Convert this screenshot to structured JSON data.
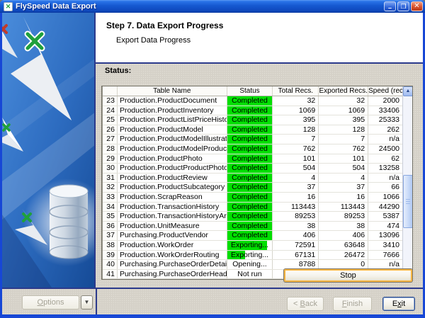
{
  "window": {
    "title": "FlySpeed Data Export"
  },
  "titlebar": {
    "minimize": "–",
    "maximize": "❐",
    "close": "✕"
  },
  "header": {
    "title": "Step 7. Data Export Progress",
    "subtitle": "Export Data Progress"
  },
  "status_label": "Status:",
  "table": {
    "columns": [
      "",
      "Table Name",
      "Status",
      "Total Recs.",
      "Exported Recs.",
      "Speed (rec/s)"
    ],
    "rows": [
      {
        "num": 23,
        "name": "Production.ProductDocument",
        "status": "Completed",
        "total": "32",
        "exported": "32",
        "speed": "2000",
        "fill": 100
      },
      {
        "num": 24,
        "name": "Production.ProductInventory",
        "status": "Completed",
        "total": "1069",
        "exported": "1069",
        "speed": "33406",
        "fill": 100
      },
      {
        "num": 25,
        "name": "Production.ProductListPriceHistory",
        "status": "Completed",
        "total": "395",
        "exported": "395",
        "speed": "25333",
        "fill": 100
      },
      {
        "num": 26,
        "name": "Production.ProductModel",
        "status": "Completed",
        "total": "128",
        "exported": "128",
        "speed": "262",
        "fill": 100
      },
      {
        "num": 27,
        "name": "Production.ProductModelIllustration",
        "status": "Completed",
        "total": "7",
        "exported": "7",
        "speed": "n/a",
        "fill": 100
      },
      {
        "num": 28,
        "name": "Production.ProductModelProductDescriptio",
        "status": "Completed",
        "total": "762",
        "exported": "762",
        "speed": "24500",
        "fill": 100
      },
      {
        "num": 29,
        "name": "Production.ProductPhoto",
        "status": "Completed",
        "total": "101",
        "exported": "101",
        "speed": "62",
        "fill": 100
      },
      {
        "num": 30,
        "name": "Production.ProductProductPhoto",
        "status": "Completed",
        "total": "504",
        "exported": "504",
        "speed": "13258",
        "fill": 100
      },
      {
        "num": 31,
        "name": "Production.ProductReview",
        "status": "Completed",
        "total": "4",
        "exported": "4",
        "speed": "n/a",
        "fill": 100
      },
      {
        "num": 32,
        "name": "Production.ProductSubcategory",
        "status": "Completed",
        "total": "37",
        "exported": "37",
        "speed": "66",
        "fill": 100
      },
      {
        "num": 33,
        "name": "Production.ScrapReason",
        "status": "Completed",
        "total": "16",
        "exported": "16",
        "speed": "1066",
        "fill": 100
      },
      {
        "num": 34,
        "name": "Production.TransactionHistory",
        "status": "Completed",
        "total": "113443",
        "exported": "113443",
        "speed": "44290",
        "fill": 100
      },
      {
        "num": 35,
        "name": "Production.TransactionHistoryArchive",
        "status": "Completed",
        "total": "89253",
        "exported": "89253",
        "speed": "5387",
        "fill": 100
      },
      {
        "num": 36,
        "name": "Production.UnitMeasure",
        "status": "Completed",
        "total": "38",
        "exported": "38",
        "speed": "474",
        "fill": 100
      },
      {
        "num": 37,
        "name": "Purchasing.ProductVendor",
        "status": "Completed",
        "total": "406",
        "exported": "406",
        "speed": "13096",
        "fill": 100
      },
      {
        "num": 38,
        "name": "Production.WorkOrder",
        "status": "Exporting...",
        "total": "72591",
        "exported": "63648",
        "speed": "3410",
        "fill": 88
      },
      {
        "num": 39,
        "name": "Production.WorkOrderRouting",
        "status": "Exporting...",
        "total": "67131",
        "exported": "26472",
        "speed": "7666",
        "fill": 40
      },
      {
        "num": 40,
        "name": "Purchasing.PurchaseOrderDetail",
        "status": "Opening...",
        "total": "8788",
        "exported": "0",
        "speed": "n/a",
        "fill": 0
      },
      {
        "num": 41,
        "name": "Purchasing.PurchaseOrderHeader",
        "status": "Not run",
        "total": "",
        "exported": "",
        "speed": "",
        "fill": 0
      }
    ]
  },
  "buttons": {
    "stop": "Stop",
    "options": {
      "pre": "",
      "key": "O",
      "post": "ptions"
    },
    "options_drop": "▼",
    "back": {
      "pre": "< ",
      "key": "B",
      "post": "ack"
    },
    "finish": {
      "pre": "",
      "key": "F",
      "post": "inish"
    },
    "exit": {
      "pre": "E",
      "key": "x",
      "post": "it"
    }
  },
  "scrollbar": {
    "up": "▲",
    "down": "▼"
  },
  "colors": {
    "completed_green": "#00df00",
    "titlebar_blue": "#1558d0",
    "divider_navy": "#2b3a8c",
    "dialog_grey": "#d5d1c8"
  }
}
